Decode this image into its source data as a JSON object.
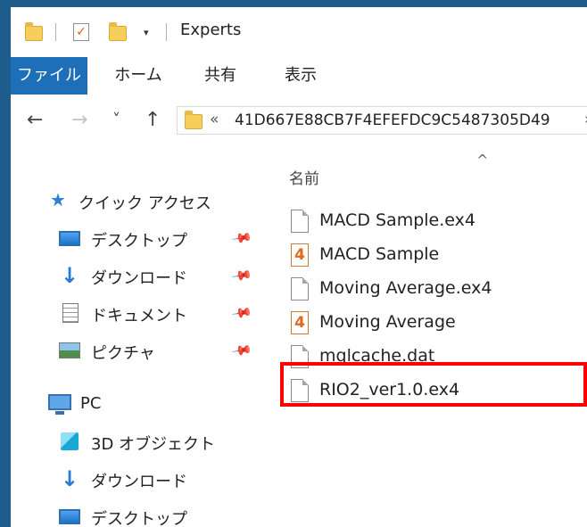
{
  "window": {
    "title": "Experts"
  },
  "quick_access_toolbar": {
    "icons": [
      "folder-icon",
      "checkmark-properties-icon",
      "new-folder-icon",
      "customize-dropdown-icon"
    ],
    "dropdown_glyph": "▾"
  },
  "ribbon": {
    "tabs": [
      {
        "label": "ファイル",
        "active": true
      },
      {
        "label": "ホーム",
        "active": false
      },
      {
        "label": "共有",
        "active": false
      },
      {
        "label": "表示",
        "active": false
      }
    ]
  },
  "address_bar": {
    "back": "←",
    "forward": "→",
    "recent": "˅",
    "up": "↑",
    "overflow": "«",
    "path": "41D667E88CB7F4EFEFDC9C5487305D49",
    "next_arrow": "›"
  },
  "navigation_pane": {
    "quick_access": {
      "label": "クイック アクセス",
      "items": [
        {
          "label": "デスクトップ",
          "icon": "desktop-icon",
          "pinned": true
        },
        {
          "label": "ダウンロード",
          "icon": "download-icon",
          "pinned": true
        },
        {
          "label": "ドキュメント",
          "icon": "documents-icon",
          "pinned": true
        },
        {
          "label": "ピクチャ",
          "icon": "pictures-icon",
          "pinned": true
        }
      ]
    },
    "pc": {
      "label": "PC",
      "items": [
        {
          "label": "3D オブジェクト",
          "icon": "3d-objects-icon"
        },
        {
          "label": "ダウンロード",
          "icon": "download-icon"
        },
        {
          "label": "デスクトップ",
          "icon": "desktop-icon"
        }
      ]
    },
    "pin_glyph": "📌"
  },
  "file_list": {
    "column_name": "名前",
    "sort_indicator": "^",
    "files": [
      {
        "name": "MACD Sample.ex4",
        "icon": "file-icon"
      },
      {
        "name": "MACD Sample",
        "icon": "mql4-source-icon"
      },
      {
        "name": "Moving Average.ex4",
        "icon": "file-icon"
      },
      {
        "name": "Moving Average",
        "icon": "mql4-source-icon"
      },
      {
        "name": "mqlcache.dat",
        "icon": "file-icon"
      },
      {
        "name": "RIO2_ver1.0.ex4",
        "icon": "file-icon",
        "highlighted": true
      }
    ],
    "mql_icon_glyph": "4"
  },
  "colors": {
    "ribbon_active_tab": "#1d6fb8",
    "highlight_border": "#ff0000",
    "background": "#1f5c8e"
  }
}
